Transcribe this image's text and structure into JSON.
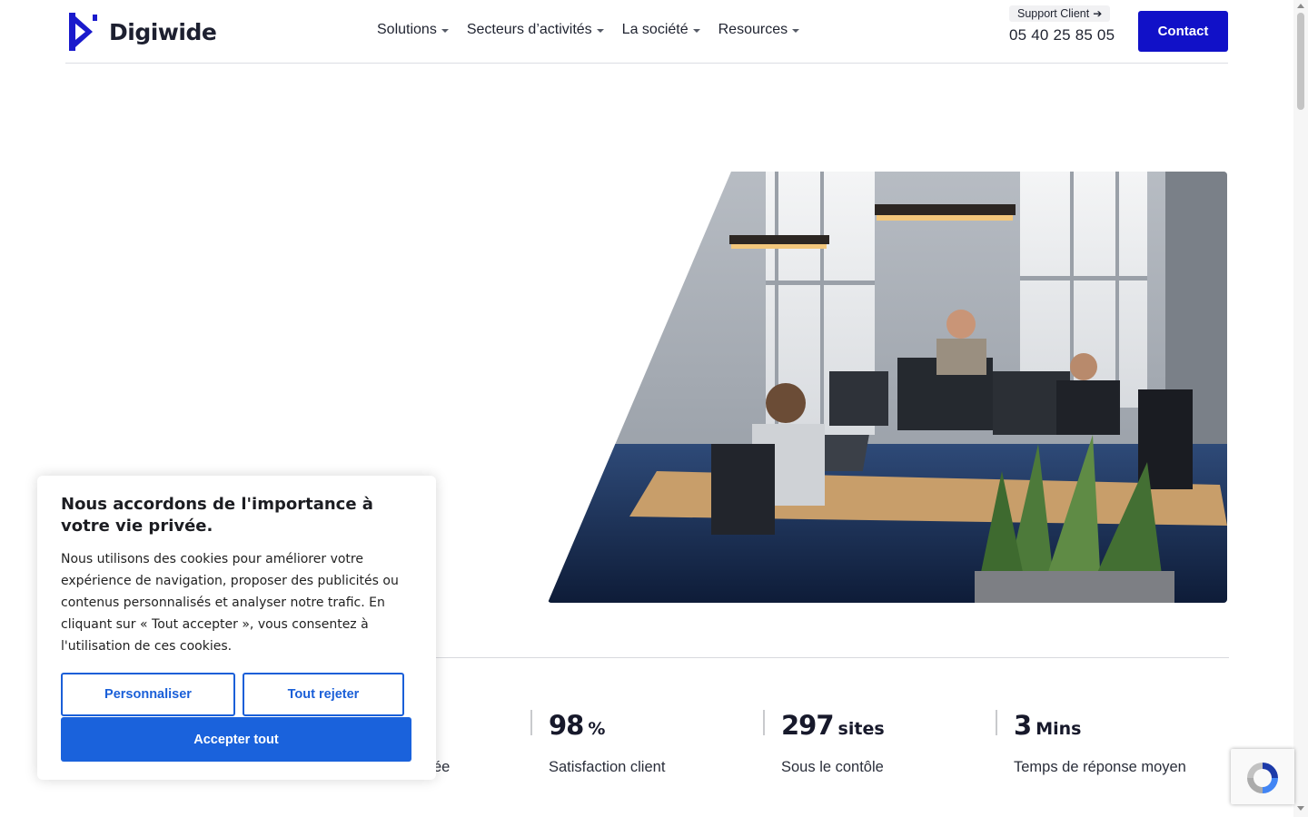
{
  "brand": {
    "name": "Digiwide",
    "color": "#1a1acc"
  },
  "nav": {
    "items": [
      {
        "label": "Solutions"
      },
      {
        "label": "Secteurs d’activités"
      },
      {
        "label": "La société"
      },
      {
        "label": "Resources"
      }
    ]
  },
  "header": {
    "support_label": "Support Client",
    "phone": "05 40 25 85 05",
    "contact_label": "Contact"
  },
  "stats": [
    {
      "value": "98",
      "unit": "%",
      "label": "Satisfaction client"
    },
    {
      "value": "297",
      "unit": "sites",
      "label": "Sous le contôle"
    },
    {
      "value": "3",
      "unit": "Mins",
      "label": "Temps de réponse moyen"
    }
  ],
  "partial_text": "ée",
  "cookie": {
    "title": "Nous accordons de l'importance à votre vie privée.",
    "text": "Nous utilisons des cookies pour améliorer votre expérience de navigation, proposer des publicités ou contenus personnalisés et analyser notre trafic. En cliquant sur « Tout accepter », vous consentez à l'utilisation de ces cookies.",
    "customize_label": "Personnaliser",
    "reject_label": "Tout rejeter",
    "accept_label": "Accepter tout"
  },
  "colors": {
    "primary": "#1111c8",
    "cookie_accent": "#1a62dc"
  }
}
